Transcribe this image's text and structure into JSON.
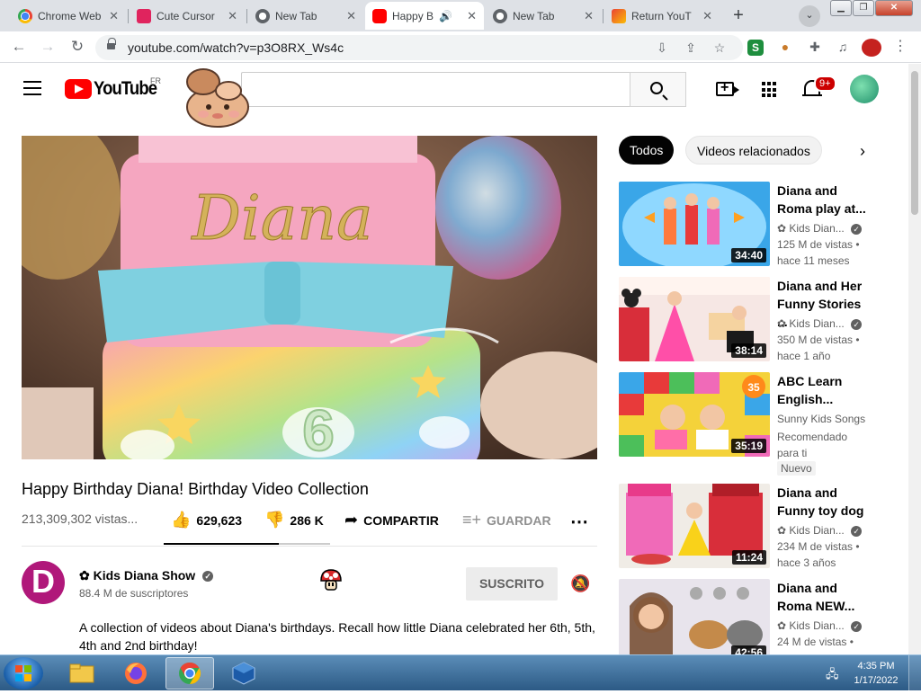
{
  "browser": {
    "tabs": [
      {
        "title": "Chrome Web",
        "icon": "chrome-icon"
      },
      {
        "title": "Cute Cursor",
        "icon": "cursor-icon"
      },
      {
        "title": "New Tab",
        "icon": "newtab-icon"
      },
      {
        "title": "Happy B",
        "icon": "youtube-icon",
        "active": true
      },
      {
        "title": "New Tab",
        "icon": "newtab-icon"
      },
      {
        "title": "Return YouT",
        "icon": "return-youtube-icon"
      }
    ],
    "new_tab_label": "+",
    "url": "youtube.com/watch?v=p3O8RX_Ws4c"
  },
  "youtube": {
    "logo_text": "YouTube",
    "country_code": "FR",
    "notification_count": "9+",
    "chips": [
      "Todos",
      "Videos relacionados"
    ],
    "video": {
      "title": "Happy Birthday Diana! Birthday Video Collection",
      "views": "213,309,302 vistas...",
      "likes": "629,623",
      "dislikes": "286 K",
      "share_label": "COMPARTIR",
      "save_label": "GUARDAR",
      "like_ratio": 0.69,
      "cake_text": "Diana"
    },
    "channel": {
      "name": "✿ Kids Diana Show",
      "subscribers": "88.4 M de suscriptores",
      "avatar_letter": "D",
      "subscribed_label": "SUSCRITO"
    },
    "description": "A collection of videos about Diana's birthdays. Recall how little Diana celebrated her 6th, 5th, 4th and 2nd birthday!",
    "recommendations": [
      {
        "title": "Diana and Roma play at...",
        "channel": "✿ Kids Dian...",
        "views": "125 M de vistas •",
        "age": "hace 11 meses",
        "duration": "34:40"
      },
      {
        "title": "Diana and Her Funny Stories ...",
        "channel": "✿ Kids Dian...",
        "views": "350 M de vistas •",
        "age": "hace 1 año",
        "duration": "38:14"
      },
      {
        "title": "ABC Learn English...",
        "channel": "Sunny Kids Songs",
        "views": "Recomendado para ti",
        "badge": "Nuevo",
        "duration": "35:19",
        "thumb_badge": "35"
      },
      {
        "title": "Diana and Funny toy dog",
        "channel": "✿ Kids Dian...",
        "views": "234 M de vistas •",
        "age": "hace 3 años",
        "duration": "11:24"
      },
      {
        "title": "Diana and Roma NEW...",
        "channel": "✿ Kids Dian...",
        "views": "24 M de vistas •",
        "duration": "42:56"
      }
    ]
  },
  "taskbar": {
    "time": "4:35 PM",
    "date": "1/17/2022"
  },
  "colors": {
    "youtube_red": "#ff0000",
    "active_chip": "#030303"
  }
}
